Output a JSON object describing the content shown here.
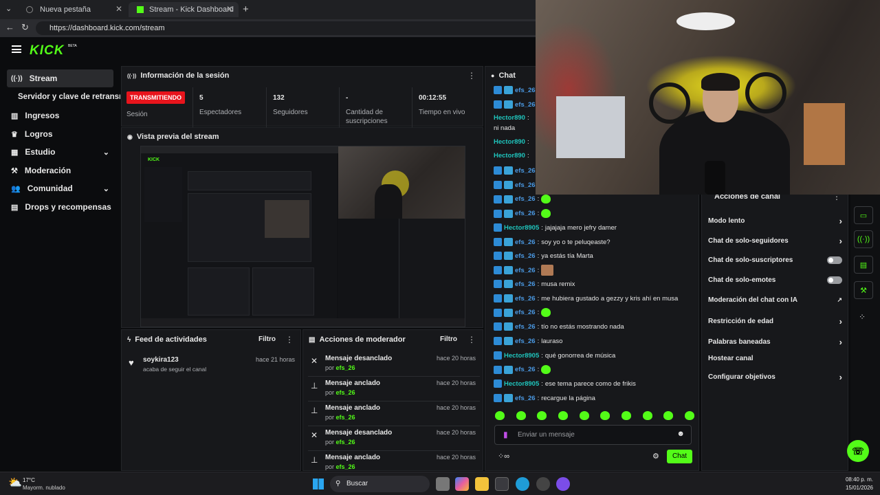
{
  "browser": {
    "tabs": [
      {
        "label": "Nueva pestaña"
      },
      {
        "label": "Stream - Kick Dashboard"
      }
    ],
    "url": "https://dashboard.kick.com/stream"
  },
  "brand": {
    "logo": "KICK",
    "beta": "BETA",
    "accent": "#53fc18"
  },
  "sidebar": {
    "items": [
      {
        "label": "Stream",
        "icon": "broadcast-icon"
      },
      {
        "label": "Servidor y clave de retransm"
      },
      {
        "label": "Ingresos",
        "icon": "chart-icon"
      },
      {
        "label": "Logros",
        "icon": "trophy-icon"
      },
      {
        "label": "Estudio",
        "icon": "grid-icon"
      },
      {
        "label": "Moderación",
        "icon": "hammer-icon"
      },
      {
        "label": "Comunidad",
        "icon": "people-icon"
      },
      {
        "label": "Drops y recompensas",
        "icon": "gift-icon"
      }
    ]
  },
  "session": {
    "title": "Información de la sesión",
    "status": "TRANSMITIENDO",
    "status_label": "Sesión",
    "stats": [
      {
        "value": "5",
        "label": "Espectadores"
      },
      {
        "value": "132",
        "label": "Seguidores"
      },
      {
        "value": "-",
        "label": "Cantidad de suscripciones"
      },
      {
        "value": "00:12:55",
        "label": "Tiempo en vivo"
      }
    ]
  },
  "preview": {
    "title": "Vista previa del stream"
  },
  "feed": {
    "title": "Feed de actividades",
    "filter": "Filtro",
    "items": [
      {
        "user": "soykira123",
        "text": "acaba de seguir el canal",
        "time": "hace 21 horas"
      }
    ]
  },
  "modactions": {
    "title": "Acciones de moderador",
    "filter": "Filtro",
    "by": "por",
    "items": [
      {
        "action": "Mensaje desanclado",
        "user": "efs_26",
        "time": "hace 20 horas"
      },
      {
        "action": "Mensaje anclado",
        "user": "efs_26",
        "time": "hace 20 horas"
      },
      {
        "action": "Mensaje anclado",
        "user": "efs_26",
        "time": "hace 20 horas"
      },
      {
        "action": "Mensaje desanclado",
        "user": "efs_26",
        "time": "hace 20 horas"
      },
      {
        "action": "Mensaje anclado",
        "user": "efs_26",
        "time": "hace 20 horas"
      }
    ]
  },
  "chat": {
    "title": "Chat",
    "messages": [
      {
        "user": "efs_26",
        "text": ""
      },
      {
        "user": "efs_26",
        "text": ""
      },
      {
        "user": "Hector890",
        "text": ""
      },
      {
        "user": "",
        "text": "ni nada"
      },
      {
        "user": "Hector890",
        "text": ""
      },
      {
        "user": "Hector890",
        "text": ""
      },
      {
        "user": "efs_26",
        "text": ""
      },
      {
        "user": "efs_26",
        "text": ""
      },
      {
        "user": "efs_26",
        "text": "",
        "emote": true
      },
      {
        "user": "efs_26",
        "text": "",
        "emote": true
      },
      {
        "user": "Hector8905",
        "text": "jajajaja mero jefry damer"
      },
      {
        "user": "efs_26",
        "text": "soy yo o te peluqeaste?"
      },
      {
        "user": "efs_26",
        "text": "ya estás tía Marta"
      },
      {
        "user": "efs_26",
        "text": "",
        "image": true
      },
      {
        "user": "efs_26",
        "text": "musa remix"
      },
      {
        "user": "efs_26",
        "text": "me hubiera gustado a gezzy y kris ahí en musa"
      },
      {
        "user": "efs_26",
        "text": "",
        "emote": true
      },
      {
        "user": "efs_26",
        "text": "tío no estás mostrando nada"
      },
      {
        "user": "efs_26",
        "text": "lauraso"
      },
      {
        "user": "Hector8905",
        "text": "qué gonorrea de música"
      },
      {
        "user": "efs_26",
        "text": "",
        "emote": true
      },
      {
        "user": "Hector8905",
        "text": "ese tema parece como de frikis"
      },
      {
        "user": "efs_26",
        "text": "recargue la página"
      }
    ],
    "input_placeholder": "Enviar un mensaje",
    "send": "Chat"
  },
  "channel_actions": {
    "title": "Acciones de canal",
    "items": [
      {
        "label": "Modo lento",
        "control": "chevron"
      },
      {
        "label": "Chat de solo-seguidores",
        "control": "chevron"
      },
      {
        "label": "Chat de solo-suscriptores",
        "control": "toggle"
      },
      {
        "label": "Chat de solo-emotes",
        "control": "toggle"
      },
      {
        "label": "Moderación del chat con IA",
        "control": "external"
      },
      {
        "label": "Restricción de edad",
        "control": "chevron"
      },
      {
        "label": "Palabras baneadas",
        "control": "chevron"
      },
      {
        "label": "Hostear canal",
        "control": "none"
      },
      {
        "label": "Configurar objetivos",
        "control": "chevron"
      }
    ]
  },
  "taskbar": {
    "weather_temp": "17°C",
    "weather_desc": "Mayorm. nublado",
    "search": "Buscar",
    "time": "08:40 p. m.",
    "date": "15/01/2026"
  }
}
